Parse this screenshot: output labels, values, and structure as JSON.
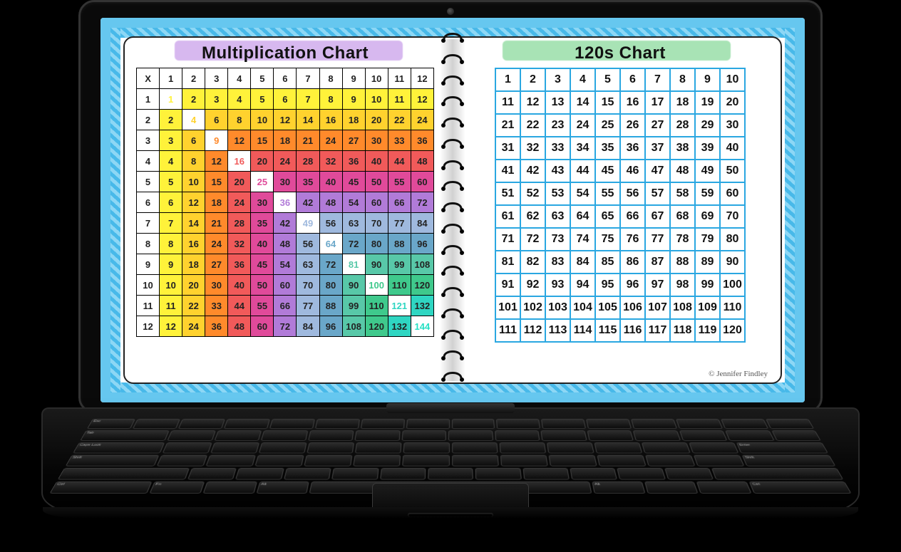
{
  "left_title": "Multiplication Chart",
  "right_title": "120s Chart",
  "credit": "© Jennifer Findley",
  "chart_data": [
    {
      "type": "table",
      "title": "Multiplication Chart",
      "description": "12×12 multiplication table; row and column headers 1–12; each cell = row × column. Diagonal perfect squares shown on white; off-diagonal cells shaded by the smaller factor (rainbow palette).",
      "row_headers": [
        1,
        2,
        3,
        4,
        5,
        6,
        7,
        8,
        9,
        10,
        11,
        12
      ],
      "col_headers": [
        1,
        2,
        3,
        4,
        5,
        6,
        7,
        8,
        9,
        10,
        11,
        12
      ],
      "values": [
        [
          1,
          2,
          3,
          4,
          5,
          6,
          7,
          8,
          9,
          10,
          11,
          12
        ],
        [
          2,
          4,
          6,
          8,
          10,
          12,
          14,
          16,
          18,
          20,
          22,
          24
        ],
        [
          3,
          6,
          9,
          12,
          15,
          18,
          21,
          24,
          27,
          30,
          33,
          36
        ],
        [
          4,
          8,
          12,
          16,
          20,
          24,
          28,
          32,
          36,
          40,
          44,
          48
        ],
        [
          5,
          10,
          15,
          20,
          25,
          30,
          35,
          40,
          45,
          50,
          55,
          60
        ],
        [
          6,
          12,
          18,
          24,
          30,
          36,
          42,
          48,
          54,
          60,
          66,
          72
        ],
        [
          7,
          14,
          21,
          28,
          35,
          42,
          49,
          56,
          63,
          70,
          77,
          84
        ],
        [
          8,
          16,
          24,
          32,
          40,
          48,
          56,
          64,
          72,
          80,
          88,
          96
        ],
        [
          9,
          18,
          27,
          36,
          45,
          54,
          63,
          72,
          81,
          90,
          99,
          108
        ],
        [
          10,
          20,
          30,
          40,
          50,
          60,
          70,
          80,
          90,
          100,
          110,
          120
        ],
        [
          11,
          22,
          33,
          44,
          55,
          66,
          77,
          88,
          99,
          110,
          121,
          132
        ],
        [
          12,
          24,
          36,
          48,
          60,
          72,
          84,
          96,
          108,
          120,
          132,
          144
        ]
      ],
      "band_colors": {
        "1": "#fff23a",
        "2": "#ffd22e",
        "3": "#ff8a2b",
        "4": "#f15a5a",
        "5": "#e04a9a",
        "6": "#b17bd8",
        "7": "#9fb9de",
        "8": "#6aa7c9",
        "9": "#58c8a8",
        "10": "#3fc98c",
        "11": "#2fd6c2",
        "12": "#25e0c4"
      }
    },
    {
      "type": "table",
      "title": "120s Chart",
      "description": "Numbers 1–120 arranged in a 12-row by 10-column grid.",
      "columns": 10,
      "rows": 12,
      "values": [
        [
          1,
          2,
          3,
          4,
          5,
          6,
          7,
          8,
          9,
          10
        ],
        [
          11,
          12,
          13,
          14,
          15,
          16,
          17,
          18,
          19,
          20
        ],
        [
          21,
          22,
          23,
          24,
          25,
          26,
          27,
          28,
          29,
          30
        ],
        [
          31,
          32,
          33,
          34,
          35,
          36,
          37,
          38,
          39,
          40
        ],
        [
          41,
          42,
          43,
          44,
          45,
          46,
          47,
          48,
          49,
          50
        ],
        [
          51,
          52,
          53,
          54,
          55,
          56,
          57,
          58,
          59,
          60
        ],
        [
          61,
          62,
          63,
          64,
          65,
          66,
          67,
          68,
          69,
          70
        ],
        [
          71,
          72,
          73,
          74,
          75,
          76,
          77,
          78,
          79,
          80
        ],
        [
          81,
          82,
          83,
          84,
          85,
          86,
          87,
          88,
          89,
          90
        ],
        [
          91,
          92,
          93,
          94,
          95,
          96,
          97,
          98,
          99,
          100
        ],
        [
          101,
          102,
          103,
          104,
          105,
          106,
          107,
          108,
          109,
          110
        ],
        [
          111,
          112,
          113,
          114,
          115,
          116,
          117,
          118,
          119,
          120
        ]
      ]
    }
  ]
}
